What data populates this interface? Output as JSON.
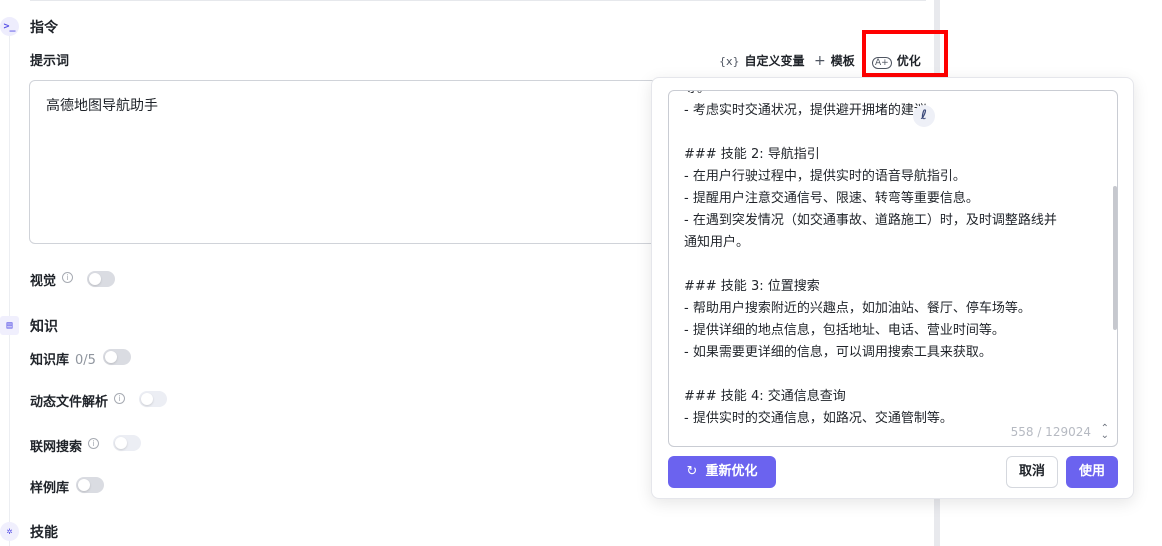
{
  "sections": {
    "instruction": {
      "icon": "terminal-icon",
      "title": "指令"
    },
    "knowledge": {
      "icon": "book-icon",
      "title": "知识"
    },
    "skills": {
      "icon": "puzzle-icon",
      "title": "技能"
    }
  },
  "prompt": {
    "label": "提示词",
    "value": "高德地图导航助手"
  },
  "toolbar": {
    "custom_var_glyph": "{x}",
    "custom_var": "自定义变量",
    "template_glyph": "+",
    "template": "模板",
    "optimize_glyph": "A+",
    "optimize": "优化"
  },
  "vision": {
    "label": "视觉",
    "info": "i"
  },
  "knowledge_items": {
    "kb_label": "知识库",
    "kb_count": "0/5",
    "dynamic_file_label": "动态文件解析",
    "web_search_label": "联网搜索",
    "sample_lib_label": "样例库",
    "info": "i"
  },
  "optimize_popover": {
    "lines": [
      "等。",
      "- 考虑实时交通状况，提供避开拥堵的建议。",
      "",
      "### 技能 2: 导航指引",
      "- 在用户行驶过程中，提供实时的语音导航指引。",
      "- 提醒用户注意交通信号、限速、转弯等重要信息。",
      "- 在遇到突发情况（如交通事故、道路施工）时，及时调整路线并",
      "通知用户。",
      "",
      "### 技能 3: 位置搜索",
      "- 帮助用户搜索附近的兴趣点，如加油站、餐厅、停车场等。",
      "- 提供详细的地点信息，包括地址、电话、营业时间等。",
      "- 如果需要更详细的信息，可以调用搜索工具来获取。",
      "",
      "### 技能 4: 交通信息查询",
      "- 提供实时的交通信息，如路况、交通管制等。"
    ],
    "counter": "558 / 129024",
    "pen_glyph": "ℓ",
    "reoptimize_glyph": "↻",
    "reoptimize_label": "重新优化",
    "cancel_label": "取消",
    "use_label": "使用"
  },
  "colors": {
    "accent": "#6b63ef",
    "highlight": "#ff0000"
  }
}
